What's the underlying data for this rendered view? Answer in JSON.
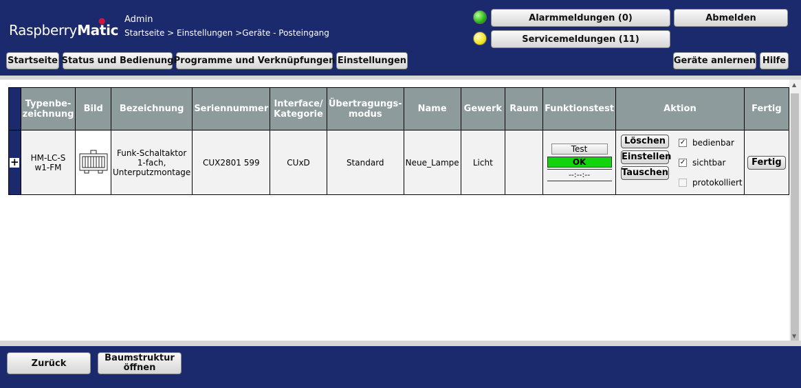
{
  "header": {
    "logo_raspberry": "Raspberry",
    "logo_matic": "Matic",
    "user": "Admin",
    "breadcrumb": "Startseite > Einstellungen >Geräte - Posteingang",
    "alarm_label": "Alarmmeldungen (0)",
    "service_label": "Servicemeldungen (11)",
    "logout_label": "Abmelden",
    "nav": [
      "Startseite",
      "Status und Bedienung",
      "Programme und Verknüpfungen",
      "Einstellungen"
    ],
    "learn_label": "Geräte anlernen",
    "help_label": "Hilfe"
  },
  "table": {
    "headers": [
      "Typenbe-zeichnung",
      "Bild",
      "Bezeichnung",
      "Seriennummer",
      "Interface/ Kategorie",
      "Übertragungs-modus",
      "Name",
      "Gewerk",
      "Raum",
      "Funktionstest",
      "Aktion",
      "Fertig"
    ],
    "row": {
      "type": "HM-LC-S w1-FM",
      "description": "Funk-Schaltaktor 1-fach, Unterputzmontage",
      "serial": "CUX2801 599",
      "interface": "CUxD",
      "mode": "Standard",
      "name": "Neue_Lampe",
      "trade": "Licht",
      "room": "",
      "test_label": "Test",
      "test_status": "OK",
      "test_time": "--:--:--",
      "delete_label": "Löschen",
      "configure_label": "Einstellen",
      "replace_label": "Tauschen",
      "check_operable": "bedienbar",
      "check_visible": "sichtbar",
      "check_logged": "protokolliert",
      "operable": true,
      "visible": true,
      "logged": false,
      "done_label": "Fertig",
      "expand_symbol": "+"
    }
  },
  "footer": {
    "back_label": "Zurück",
    "tree_label_1": "Baumstruktur",
    "tree_label_2": "öffnen"
  },
  "colors": {
    "header_bg": "#1b2a6d",
    "table_header_bg": "#8d9b9d",
    "status_ok": "#13d40c",
    "led_alarm": "#29b915",
    "led_service": "#f3e51f"
  }
}
